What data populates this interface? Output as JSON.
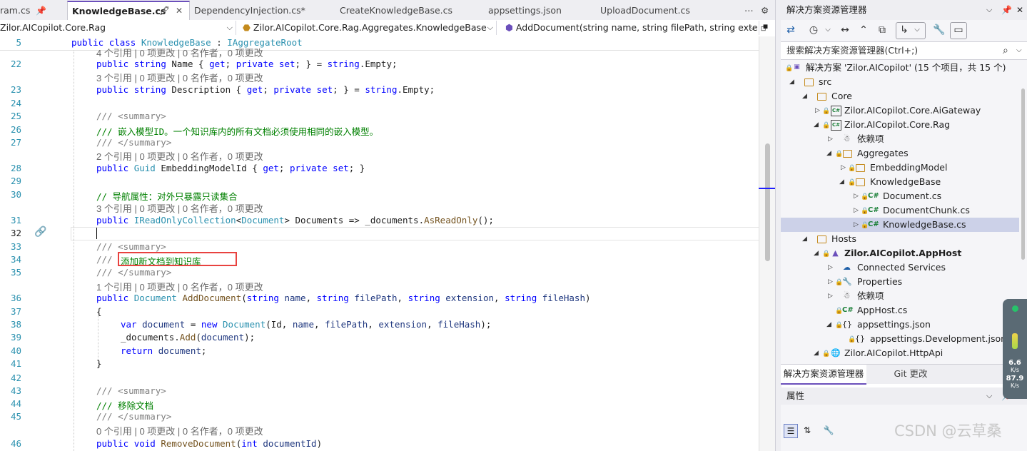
{
  "tabs": [
    {
      "label": "ram.cs",
      "pinned": true
    },
    {
      "label": "KnowledgeBase.cs",
      "active": true
    },
    {
      "label": "DependencyInjection.cs*"
    },
    {
      "label": "CreateKnowledgeBase.cs"
    },
    {
      "label": "appsettings.json"
    },
    {
      "label": "UploadDocument.cs"
    }
  ],
  "navbar": {
    "project": "Zilor.AICopilot.Core.Rag",
    "type": "Zilor.AICopilot.Core.Rag.Aggregates.KnowledgeBase",
    "member": "AddDocument(string name, string filePath, string exte"
  },
  "editor": {
    "sticky_line_no": "5",
    "lines": {
      "n22": "22",
      "n23": "23",
      "n24": "24",
      "n25": "25",
      "n26": "26",
      "n27": "27",
      "n28": "28",
      "n29": "29",
      "n30": "30",
      "n31": "31",
      "n32": "32",
      "n33": "33",
      "n34": "34",
      "n35": "35",
      "n36": "36",
      "n37": "37",
      "n38": "38",
      "n39": "39",
      "n40": "40",
      "n41": "41",
      "n42": "42",
      "n43": "43",
      "n44": "44",
      "n45": "45",
      "n46": "46"
    },
    "lens": {
      "top": "4 个引用 | 0 项更改 | 0 名作者，0 项更改",
      "name": "3 个引用 | 0 项更改 | 0 名作者，0 项更改",
      "embed": "2 个引用 | 0 项更改 | 0 名作者，0 项更改",
      "docs": "3 个引用 | 0 项更改 | 0 名作者，0 项更改",
      "add": "1 个引用 | 0 项更改 | 0 名作者，0 项更改",
      "remove": "0 个引用 | 0 项更改 | 0 名作者，0 项更改"
    },
    "comments": {
      "summary_open": "/// <summary>",
      "summary_close": "/// </summary>",
      "embed_doc": "/// 嵌入模型ID。一个知识库内的所有文档必须使用相同的嵌入模型。",
      "nav_prop": "// 导航属性：对外只暴露只读集合",
      "add_doc_prefix": "///",
      "add_doc": "添加新文档到知识库",
      "remove_doc": "/// 移除文档"
    }
  },
  "solution_explorer": {
    "title": "解决方案资源管理器",
    "search_placeholder": "搜索解决方案资源管理器(Ctrl+;)",
    "tree": [
      {
        "label": "解决方案 'Zilor.AICopilot' (15 个项目，共 15 个)",
        "icon": "solution"
      },
      {
        "label": "src",
        "icon": "folder"
      },
      {
        "label": "Core",
        "icon": "folder"
      },
      {
        "label": "Zilor.AICopilot.Core.AiGateway",
        "icon": "csproj"
      },
      {
        "label": "Zilor.AICopilot.Core.Rag",
        "icon": "csproj"
      },
      {
        "label": "依赖项",
        "icon": "dependencies"
      },
      {
        "label": "Aggregates",
        "icon": "folder"
      },
      {
        "label": "EmbeddingModel",
        "icon": "folder"
      },
      {
        "label": "KnowledgeBase",
        "icon": "folder"
      },
      {
        "label": "Document.cs",
        "icon": "cs"
      },
      {
        "label": "DocumentChunk.cs",
        "icon": "cs"
      },
      {
        "label": "KnowledgeBase.cs",
        "icon": "cs",
        "selected": true
      },
      {
        "label": "Hosts",
        "icon": "folder"
      },
      {
        "label": "Zilor.AICopilot.AppHost",
        "icon": "apphost",
        "bold": true
      },
      {
        "label": "Connected Services",
        "icon": "connected"
      },
      {
        "label": "Properties",
        "icon": "properties"
      },
      {
        "label": "依赖项",
        "icon": "dependencies"
      },
      {
        "label": "AppHost.cs",
        "icon": "cs"
      },
      {
        "label": "appsettings.json",
        "icon": "json"
      },
      {
        "label": "appsettings.Development.json",
        "icon": "json"
      },
      {
        "label": "Zilor.AICopilot.HttpApi",
        "icon": "web"
      }
    ],
    "bottom_tabs": [
      "解决方案资源管理器",
      "Git 更改"
    ]
  },
  "properties": {
    "title": "属性"
  },
  "net_widget": {
    "up": "6.6",
    "up_unit": "K/s",
    "down": "87.9",
    "down_unit": "K/s"
  },
  "watermark": "CSDN @云草桑",
  "colors": {
    "keyword": "#0000ff",
    "type": "#2b91af",
    "comment": "#008000",
    "method": "#74531f",
    "highlight_box": "#e8423f",
    "selection": "#ccd1e8"
  }
}
